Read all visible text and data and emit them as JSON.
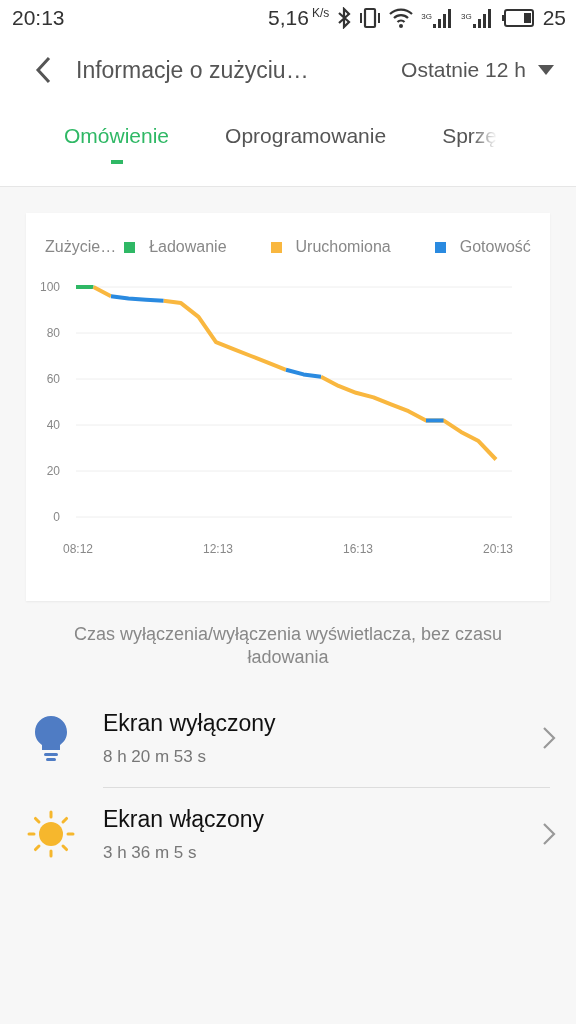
{
  "status_bar": {
    "time": "20:13",
    "speed": "5,16",
    "speed_unit": "K/s",
    "network_labels": [
      "3G",
      "3G"
    ],
    "battery": "25"
  },
  "header": {
    "title": "Informacje o zużyciu…",
    "period": "Ostatnie 12 h"
  },
  "tabs": [
    {
      "label": "Omówienie",
      "selected": true
    },
    {
      "label": "Oprogramowanie",
      "selected": false
    },
    {
      "label": "Sprzę",
      "selected": false
    }
  ],
  "chart": {
    "legend_title": "Zużycie…",
    "chart_data": {
      "type": "line",
      "categories": [
        "08:12",
        null,
        null,
        null,
        null,
        null,
        null,
        null,
        "12:13",
        null,
        null,
        null,
        null,
        null,
        null,
        null,
        "16:13",
        null,
        null,
        null,
        null,
        null,
        null,
        null,
        "20:13"
      ],
      "series": [
        {
          "name": "Ładowanie",
          "color": "#2fb865",
          "values": [
            100,
            100,
            null,
            null,
            null,
            null,
            null,
            null,
            null,
            null,
            null,
            null,
            null,
            null,
            null,
            null,
            null,
            null,
            null,
            null,
            null,
            null,
            null,
            null,
            null
          ]
        },
        {
          "name": "Uruchomiona",
          "color": "#f9b73f",
          "values": [
            null,
            100,
            96,
            null,
            null,
            94,
            93,
            87,
            76,
            73,
            70,
            67,
            64,
            null,
            61,
            57,
            54,
            52,
            49,
            46,
            42,
            42,
            37,
            33,
            25
          ]
        },
        {
          "name": "Gotowość",
          "color": "#2a8ae0",
          "values": [
            null,
            null,
            96,
            95,
            94.5,
            94,
            null,
            null,
            null,
            null,
            null,
            null,
            64,
            62,
            61,
            null,
            null,
            null,
            null,
            null,
            42,
            42,
            null,
            null,
            null
          ]
        }
      ],
      "ylim": [
        0,
        100
      ],
      "yticks": [
        0,
        20,
        40,
        60,
        80,
        100
      ],
      "grid": true
    }
  },
  "caption": "Czas wyłączenia/wyłączenia wyświetlacza, bez czasu ładowania",
  "items": [
    {
      "kind": "screen_off",
      "title": "Ekran wyłączony",
      "duration": "8 h 20 m 53 s"
    },
    {
      "kind": "screen_on",
      "title": "Ekran włączony",
      "duration": "3 h 36 m 5 s"
    }
  ]
}
